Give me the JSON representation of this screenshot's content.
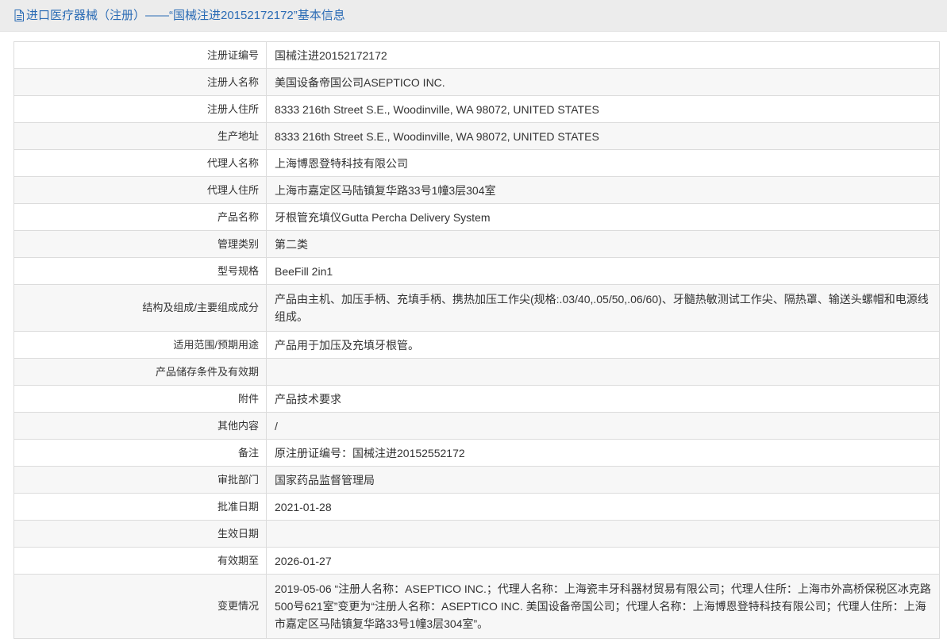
{
  "header": {
    "title": "进口医疗器械（注册）——“国械注进20152172172”基本信息",
    "icon": "document-icon",
    "accent_color": "#2a6bb5"
  },
  "rows": [
    {
      "label": "注册证编号",
      "value": "国械注进20152172172"
    },
    {
      "label": "注册人名称",
      "value": "美国设备帝国公司ASEPTICO INC."
    },
    {
      "label": "注册人住所",
      "value": "8333 216th Street S.E., Woodinville, WA 98072, UNITED STATES"
    },
    {
      "label": "生产地址",
      "value": "8333 216th Street S.E., Woodinville, WA 98072, UNITED STATES"
    },
    {
      "label": "代理人名称",
      "value": "上海博恩登特科技有限公司"
    },
    {
      "label": "代理人住所",
      "value": "上海市嘉定区马陆镇复华路33号1幢3层304室"
    },
    {
      "label": "产品名称",
      "value": "牙根管充填仪Gutta Percha Delivery System"
    },
    {
      "label": "管理类别",
      "value": "第二类"
    },
    {
      "label": "型号规格",
      "value": "BeeFill 2in1"
    },
    {
      "label": "结构及组成/主要组成成分",
      "value": "产品由主机、加压手柄、充填手柄、携热加压工作尖(规格:.03/40,.05/50,.06/60)、牙髓热敏测试工作尖、隔热罩、输送头螺帽和电源线组成。"
    },
    {
      "label": "适用范围/预期用途",
      "value": "产品用于加压及充填牙根管。"
    },
    {
      "label": "产品储存条件及有效期",
      "value": ""
    },
    {
      "label": "附件",
      "value": "产品技术要求"
    },
    {
      "label": "其他内容",
      "value": "/"
    },
    {
      "label": "备注",
      "value": "原注册证编号：国械注进20152552172"
    },
    {
      "label": "审批部门",
      "value": "国家药品监督管理局"
    },
    {
      "label": "批准日期",
      "value": "2021-01-28"
    },
    {
      "label": "生效日期",
      "value": ""
    },
    {
      "label": "有效期至",
      "value": "2026-01-27"
    },
    {
      "label": "变更情况",
      "value": "2019-05-06 “注册人名称：ASEPTICO INC.；代理人名称：上海瓷丰牙科器材贸易有限公司；代理人住所：上海市外高桥保税区冰克路500号621室”变更为“注册人名称：ASEPTICO INC. 美国设备帝国公司；代理人名称：上海博恩登特科技有限公司；代理人住所：上海市嘉定区马陆镇复华路33号1幢3层304室”。"
    }
  ]
}
